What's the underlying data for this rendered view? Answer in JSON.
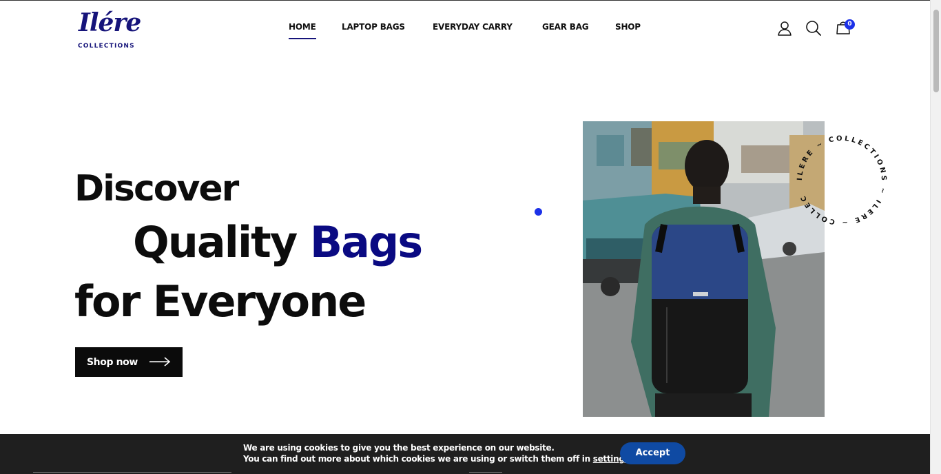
{
  "brand": {
    "logo_script": "Ilére",
    "logo_sub": "COLLECTIONS"
  },
  "nav": {
    "items": [
      {
        "label": "HOME",
        "active": true
      },
      {
        "label": "LAPTOP BAGS",
        "active": false
      },
      {
        "label": "EVERYDAY CARRY",
        "active": false
      },
      {
        "label": "GEAR BAG",
        "active": false
      },
      {
        "label": "SHOP",
        "active": false
      }
    ]
  },
  "header_icons": {
    "account": "user-icon",
    "search": "search-icon",
    "cart": "shopping-bag-icon",
    "cart_count": "0"
  },
  "hero": {
    "line1": "Discover",
    "line2_main": "Quality ",
    "line2_accent": "Bags",
    "line3": "for Everyone",
    "cta_label": "Shop now",
    "circular_text": "ILERE ~ COLLECTIONS ~ ILERE ~ COLLEC"
  },
  "cookie": {
    "line1": "We are using cookies to give you the best experience on our website.",
    "line2_prefix": "You can find out more about which cookies we are using or switch them off in ",
    "line2_link": "settings",
    "line2_suffix": ".",
    "accept_label": "Accept"
  },
  "colors": {
    "brand_navy": "#16147a",
    "accent_blue": "#1c31e8",
    "accept_blue": "#0f4aa3",
    "cookie_bg": "#1f1f1f"
  }
}
